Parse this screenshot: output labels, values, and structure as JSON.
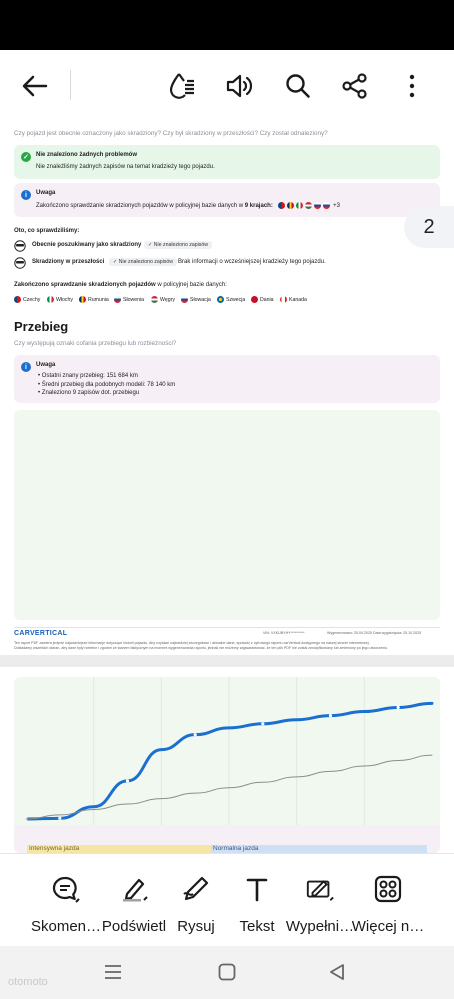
{
  "colors": {
    "accent": "#1a6fd1",
    "ok": "#28a745",
    "info": "#1a6fd1",
    "ok_bg": "#e6f7e9",
    "info_bg": "#f7eff6"
  },
  "toolbar": {
    "back": "arrow-left-icon",
    "icons": [
      "reading-mode-icon",
      "speaker-icon",
      "search-icon",
      "share-icon",
      "more-icon"
    ]
  },
  "page_indicator": "2",
  "theft": {
    "subtitle": "Czy pojazd jest obecnie oznaczony jako skradziony? Czy był skradziony w przeszłości? Czy został odnaleziony?",
    "ok_title": "Nie znaleziono żadnych problemów",
    "ok_text": "Nie znaleźliśmy żadnych zapisów na temat kradzieży tego pojazdu.",
    "note_title": "Uwaga",
    "note_text_pre": "Zakończono sprawdzanie skradzionych pojazdów w policyjnej bazie danych w",
    "note_text_bold": "9 krajach:",
    "note_more": "+3",
    "checked_heading": "Oto, co sprawdziliśmy:",
    "checks": [
      {
        "label": "Obecnie poszukiwany jako skradziony",
        "status": "Nie znaleziono zapisów",
        "extra": ""
      },
      {
        "label": "Skradziony w przeszłości",
        "status": "Nie znaleziono zapisów",
        "extra": "Brak informacji o wcześniejszej kradzieży tego pojazdu."
      }
    ],
    "db_heading_bold": "Zakończono sprawdzanie skradzionych pojazdów",
    "db_heading_rest": "w policyjnej bazie danych:",
    "countries": [
      "Czechy",
      "Włochy",
      "Rumunia",
      "Słowenia",
      "Węgry",
      "Słowacja",
      "Szwecja",
      "Dania",
      "Kanada"
    ]
  },
  "mileage": {
    "title": "Przebieg",
    "subtitle": "Czy występują oznaki cofania przebiegu lub rozbieżności?",
    "note_title": "Uwaga",
    "items": [
      "Ostatni znany przebieg: 151 684 km",
      "Średni przebieg dla podobnych modeli: 78 140 km",
      "Znaleziono 9 zapisów dot. przebiegu"
    ]
  },
  "footer": {
    "brand": "CARVERTICAL",
    "vin": "VIN: VXKUBYHY**********",
    "generated": "Wygenerowano: 25.09.2025",
    "valid": "Data wygaśnięcia: 25.10.2025",
    "disclaimer1": "Ten raport PDF zawiera jedynie najważniejsze informacje dotyczące historii pojazdu. Aby uzyskać najbardziej szczegółowe i aktualne dane, sprawdź z cyfrowego raportu carVertical dostępnego na naszej stronie internetowej.",
    "disclaimer2": "Dokładamy wszelkich starań, aby dane były rzetelne i zgodne ze stanem faktycznym na moment wygenerowania raportu, jednak nie możemy zagwarantować, że ten plik PDF nie został zmodyfikowany lub zmieniony po jego utworzeniu."
  },
  "chart2": {
    "band_left": "Intensywna jazda",
    "band_right": "Normalna jazda"
  },
  "chart_data": {
    "type": "line",
    "title": "",
    "series": [
      {
        "values": [
          0,
          0.005,
          0.09,
          0.28,
          0.51,
          0.62,
          0.67,
          0.7,
          0.73,
          0.76,
          0.79,
          0.82,
          0.85
        ]
      },
      {
        "values": [
          0,
          0.03,
          0.07,
          0.11,
          0.15,
          0.19,
          0.23,
          0.27,
          0.31,
          0.35,
          0.39,
          0.43,
          0.47
        ]
      }
    ],
    "grid": true
  },
  "bottom_tools": [
    {
      "label": "Skomen…",
      "icon": "comment-icon"
    },
    {
      "label": "Podświetl",
      "icon": "highlighter-icon"
    },
    {
      "label": "Rysuj",
      "icon": "pen-icon"
    },
    {
      "label": "Tekst",
      "icon": "text-icon"
    },
    {
      "label": "Wypełni…",
      "icon": "fill-sign-icon"
    },
    {
      "label": "Więcej n…",
      "icon": "grid-icon"
    }
  ],
  "nav": [
    "recent-apps-icon",
    "home-icon",
    "back-triangle-icon"
  ],
  "watermark": "otomoto"
}
